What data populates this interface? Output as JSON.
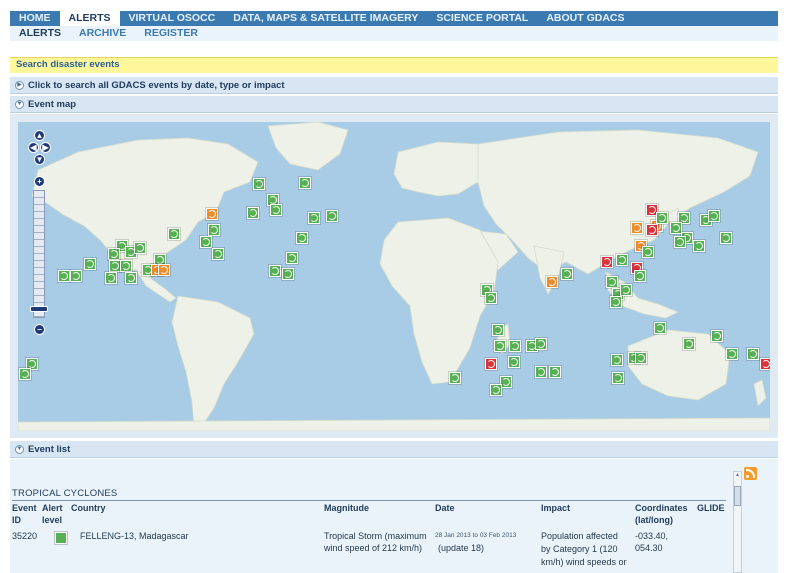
{
  "top_nav": {
    "items": [
      "HOME",
      "ALERTS",
      "VIRTUAL OSOCC",
      "DATA, MAPS & SATELLITE IMAGERY",
      "SCIENCE PORTAL",
      "ABOUT GDACS"
    ],
    "active": "ALERTS"
  },
  "sub_nav": {
    "items": [
      "ALERTS",
      "ARCHIVE",
      "REGISTER"
    ],
    "active": "ALERTS"
  },
  "search_bar": {
    "label": "Search disaster events"
  },
  "panels": {
    "search": {
      "label": "Click to search all GDACS events by date, type or impact"
    },
    "map": {
      "label": "Event map"
    },
    "list": {
      "label": "Event list"
    }
  },
  "event_list": {
    "category": "TROPICAL CYCLONES",
    "columns": {
      "event_id": "Event ID",
      "alert_level": "Alert level",
      "country": "Country",
      "magnitude": "Magnitude",
      "date": "Date",
      "impact": "Impact",
      "coordinates": "Coordinates (lat/long)",
      "glide": "GLIDE"
    },
    "rows": [
      {
        "event_id": "35220",
        "alert_level": "green",
        "country": "FELLENG-13,  Madagascar",
        "magnitude_line1": "Tropical Storm (maximum",
        "magnitude_line2": "wind speed of 212 km/h)",
        "date_range": "28 Jan 2013  to  03 Feb 2013",
        "date_update": "(update 18)",
        "impact_line1": "Population affected",
        "impact_line2": "by Category 1 (120",
        "impact_line3": "km/h) wind speeds or",
        "lat": "-033.40,",
        "long": "054.30"
      }
    ]
  },
  "colors": {
    "nav_bar": "#3b7ab0",
    "green_alert": "#58b054",
    "orange_alert": "#ee8c2b",
    "red_alert": "#d9343a",
    "ocean": "#a8cbe6"
  },
  "icons": {
    "marker": "cyclone-icon",
    "rss": "rss-icon",
    "collapse": "circle-chevron-icon"
  }
}
